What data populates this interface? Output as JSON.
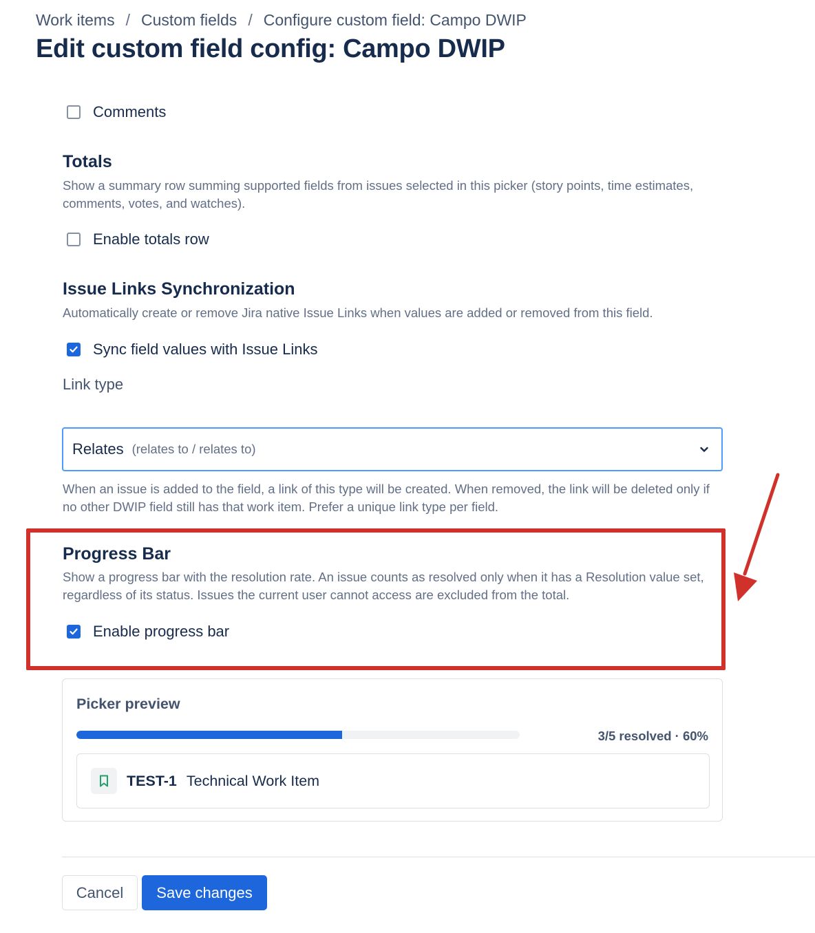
{
  "breadcrumb": {
    "items": [
      "Work items",
      "Custom fields",
      "Configure custom field: Campo DWIP"
    ],
    "separator": "/"
  },
  "page_title": "Edit custom field config: Campo DWIP",
  "comments": {
    "label": "Comments",
    "checked": false
  },
  "totals": {
    "heading": "Totals",
    "description": "Show a summary row summing supported fields from issues selected in this picker (story points, time estimates, comments, votes, and watches).",
    "checkbox_label": "Enable totals row",
    "checked": false
  },
  "issue_links": {
    "heading": "Issue Links Synchronization",
    "description": "Automatically create or remove Jira native Issue Links when values are added or removed from this field.",
    "checkbox_label": "Sync field values with Issue Links",
    "checked": true,
    "link_type_label": "Link type",
    "link_type_value": "Relates",
    "link_type_hint": "(relates to / relates to)",
    "help_text": "When an issue is added to the field, a link of this type will be created. When removed, the link will be deleted only if no other DWIP field still has that work item. Prefer a unique link type per field."
  },
  "progress_bar": {
    "heading": "Progress Bar",
    "description": "Show a progress bar with the resolution rate. An issue counts as resolved only when it has a Resolution value set, regardless of its status. Issues the current user cannot access are excluded from the total.",
    "checkbox_label": "Enable progress bar",
    "checked": true
  },
  "preview": {
    "title": "Picker preview",
    "progress_fraction": 0.6,
    "progress_text": "3/5 resolved · 60%",
    "item_key": "TEST-1",
    "item_summary": "Technical Work Item",
    "item_icon": "bookmark-icon"
  },
  "buttons": {
    "cancel": "Cancel",
    "save": "Save changes"
  },
  "colors": {
    "primary": "#1d66dc",
    "annotation": "#d0312b",
    "focus_border": "#4c9aff",
    "story_icon": "#22a06b"
  }
}
